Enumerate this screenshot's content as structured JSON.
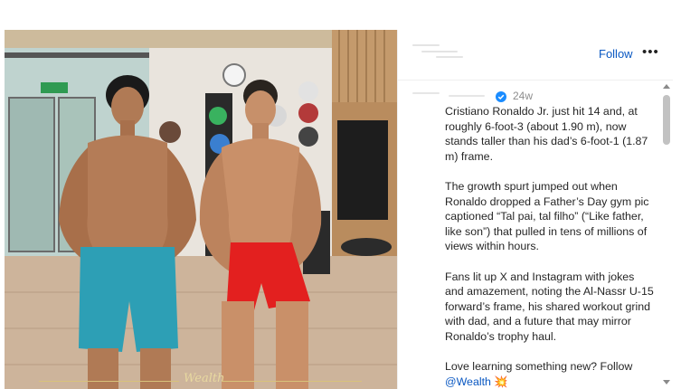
{
  "post": {
    "follow_label": "Follow",
    "more_icon": "more-horizontal-icon",
    "time_ago": "24w",
    "watermark": "Wealth",
    "caption_paragraphs": [
      "Cristiano Ronaldo Jr. just hit 14 and, at roughly 6-foot-3 (about 1.90 m), now stands taller than his dad’s 6-foot-1 (1.87 m) frame.",
      "The growth spurt jumped out when Ronaldo dropped a Father’s Day gym pic captioned “Tal pai, tal filho” (“Like father, like son”) that pulled in tens of millions of views within hours.",
      "Fans lit up X and Instagram with jokes and amazement, noting the Al-Nassr U-15 forward’s frame, his shared workout grind with dad, and a future that may mirror Ronaldo’s trophy haul."
    ],
    "cta_text": "Love learning something new? Follow",
    "mention": "@Wealth",
    "cta_emoji": "💥"
  },
  "colors": {
    "link": "#0a58c2",
    "text": "#262626",
    "muted": "#8e8e8e",
    "verified": "#1a8cff"
  }
}
